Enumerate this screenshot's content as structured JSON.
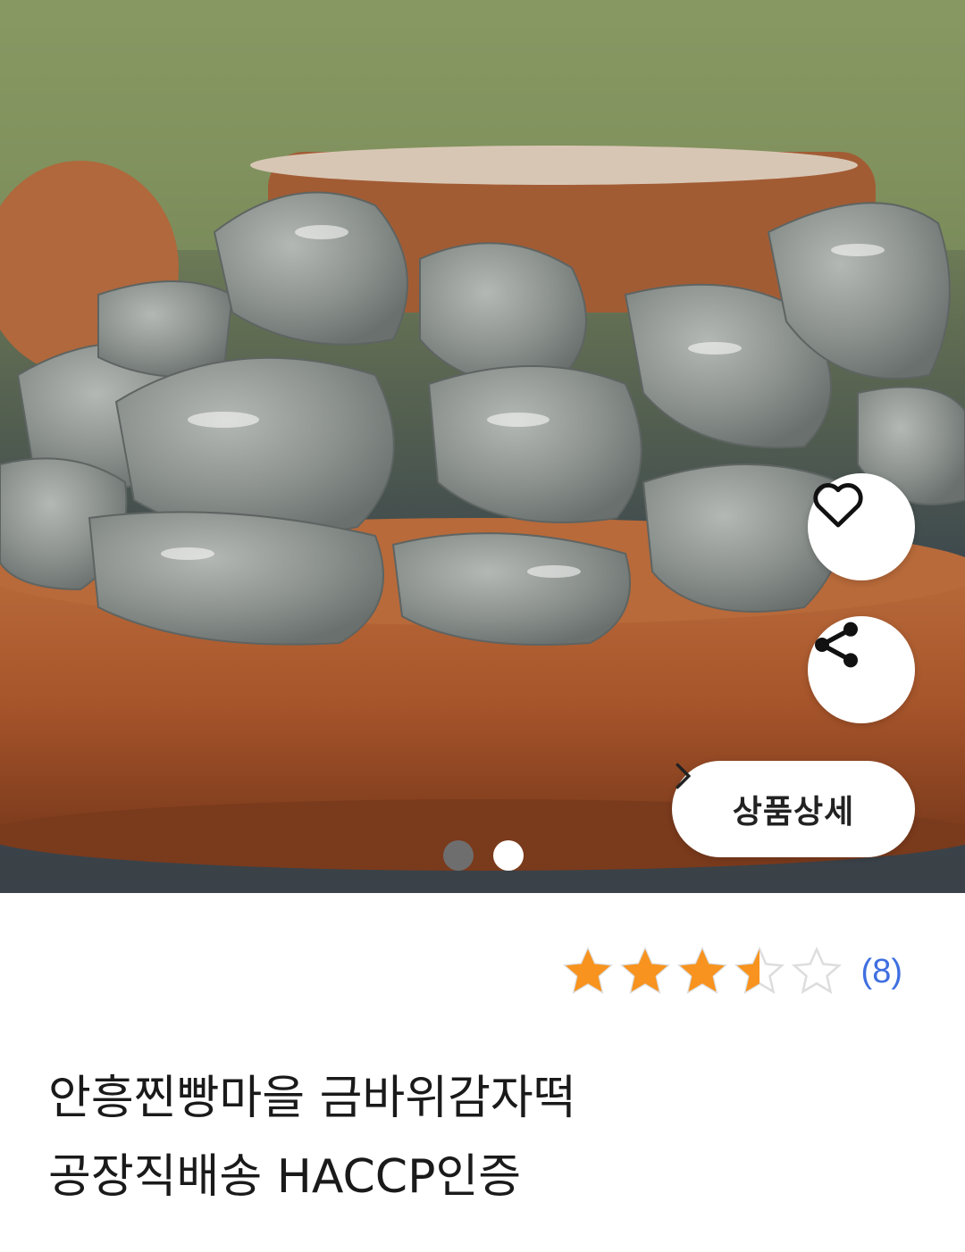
{
  "product": {
    "image_alt": "금바위감자떡",
    "title_line1": "안흥찐빵마을 금바위감자떡",
    "title_line2": "공장직배송 HACCP인증",
    "detail_button_label": "상품상세",
    "rating": {
      "value": 3.5,
      "max": 5,
      "count_text": "(8)"
    }
  },
  "carousel": {
    "current_page": 2,
    "total_pages": 2
  },
  "icons": {
    "heart": "heart-outline-icon",
    "share": "share-icon",
    "chevron": "chevron-right-icon",
    "star": "star-icon"
  },
  "colors": {
    "star_filled": "#f7931e",
    "star_empty": "#dddddd",
    "count": "#3f6fe0"
  }
}
